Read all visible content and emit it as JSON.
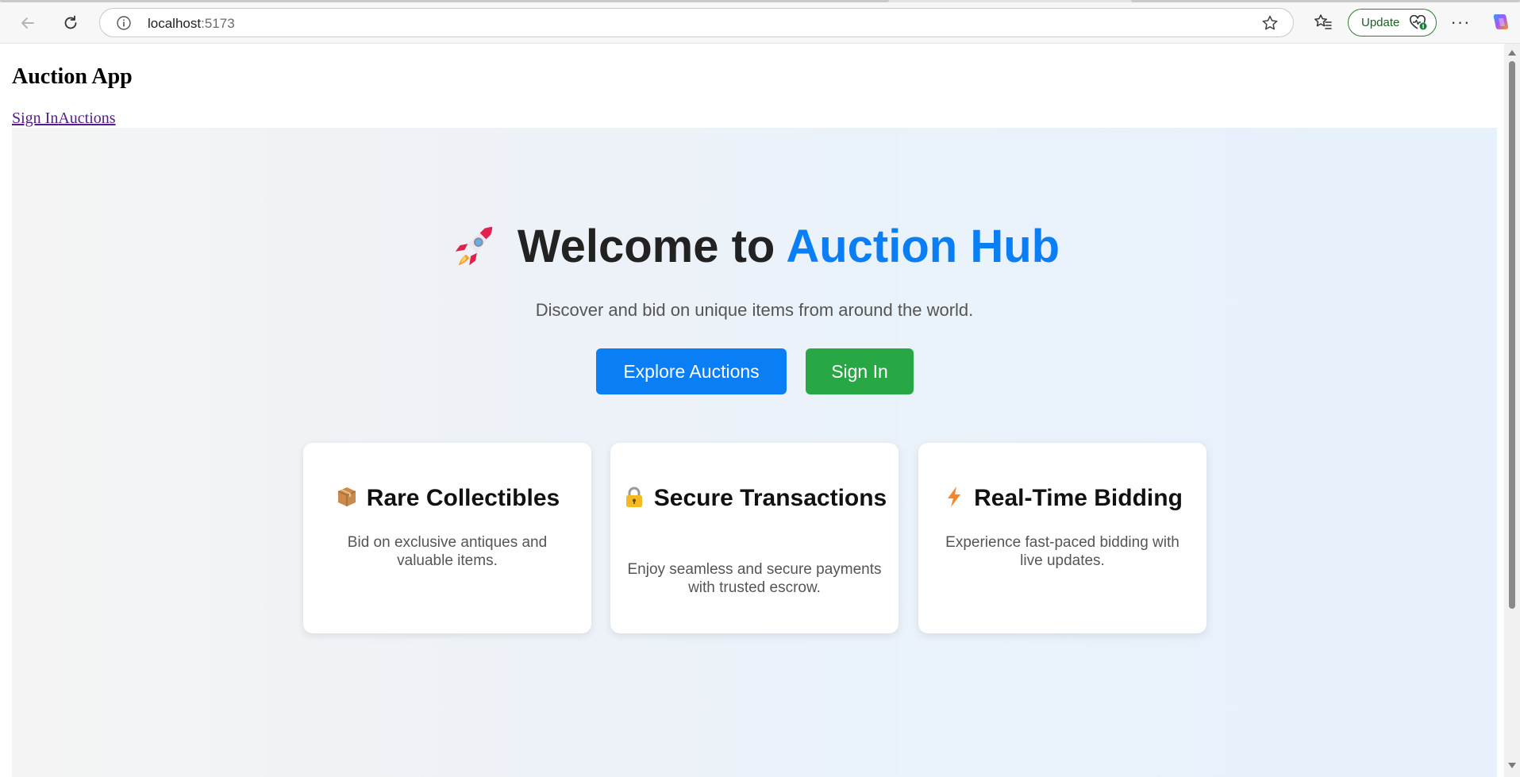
{
  "browser": {
    "url_host": "localhost",
    "url_port": ":5173",
    "update_label": "Update",
    "more_label": "···"
  },
  "app": {
    "title": "Auction App",
    "nav": {
      "signin_link": "Sign In",
      "auctions_link": "Auctions"
    }
  },
  "hero": {
    "heading_prefix": "Welcome to",
    "heading_accent": "Auction Hub",
    "subtitle": "Discover and bid on unique items from around the world.",
    "explore_button": "Explore Auctions",
    "signin_button": "Sign In",
    "accent_color": "#0a7ef5",
    "success_color": "#28a745"
  },
  "features": [
    {
      "icon": "package-icon",
      "title": "Rare Collectibles",
      "desc": "Bid on exclusive antiques and valuable items."
    },
    {
      "icon": "lock-icon",
      "title": "Secure Transactions",
      "desc": "Enjoy seamless and secure payments with trusted escrow."
    },
    {
      "icon": "lightning-icon",
      "title": "Real-Time Bidding",
      "desc": "Experience fast-paced bidding with live updates."
    }
  ]
}
